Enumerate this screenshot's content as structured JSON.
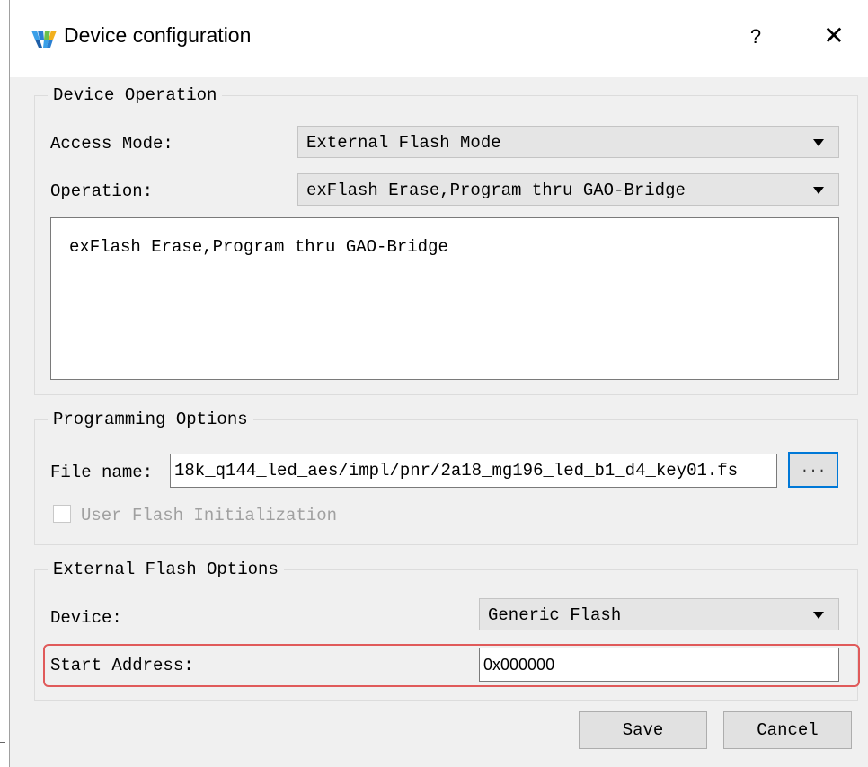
{
  "window": {
    "title": "Device configuration",
    "help_label": "?",
    "close_label": "✕",
    "app_icon": "gowin-logo-icon"
  },
  "device_operation": {
    "group_title": "Device Operation",
    "access_mode_label": "Access Mode:",
    "access_mode_value": "External Flash Mode",
    "operation_label": "Operation:",
    "operation_value": "exFlash Erase,Program thru GAO-Bridge",
    "description": "exFlash Erase,Program thru GAO-Bridge"
  },
  "programming_options": {
    "group_title": "Programming Options",
    "file_name_label": "File name:",
    "file_name_value": "18k_q144_led_aes/impl/pnr/2a18_mg196_led_b1_d4_key01.fs",
    "browse_label": "...",
    "user_flash_label": "User Flash Initialization"
  },
  "external_flash_options": {
    "group_title": "External Flash Options",
    "device_label": "Device:",
    "device_value": "Generic Flash",
    "start_address_label": "Start Address:",
    "start_address_value": "0x000000"
  },
  "buttons": {
    "save": "Save",
    "cancel": "Cancel"
  },
  "colors": {
    "highlight": "#e05a5a",
    "focus": "#0078d7",
    "dialog_bg": "#f0f0f0"
  }
}
